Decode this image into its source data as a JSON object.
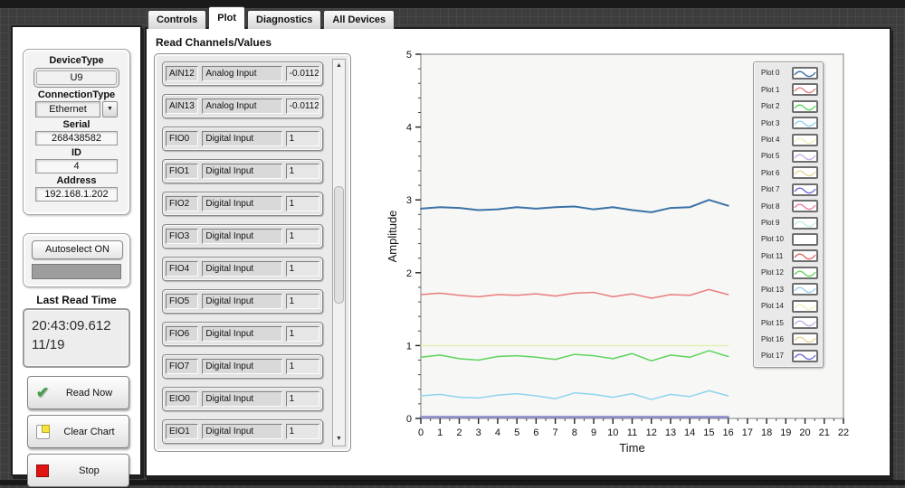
{
  "tabs": {
    "items": [
      {
        "label": "Controls",
        "active": false
      },
      {
        "label": "Plot",
        "active": true
      },
      {
        "label": "Diagnostics",
        "active": false
      },
      {
        "label": "All Devices",
        "active": false
      }
    ]
  },
  "device_panel": {
    "device_type_label": "DeviceType",
    "device_type_value": "U9",
    "connection_type_label": "ConnectionType",
    "connection_type_value": "Ethernet",
    "serial_label": "Serial",
    "serial_value": "268438582",
    "id_label": "ID",
    "id_value": "4",
    "address_label": "Address",
    "address_value": "192.168.1.202",
    "autoselect_button": "Autoselect ON",
    "last_read_time_label": "Last Read Time",
    "last_read_time_line1": "20:43:09.612",
    "last_read_time_line2": "11/19",
    "read_now_button": "Read Now",
    "clear_chart_button": "Clear Chart",
    "stop_button": "Stop"
  },
  "icons": {
    "dropdown_arrow": "▼",
    "scroll_up": "▲",
    "scroll_down": "▼"
  },
  "channels": {
    "header": "Read Channels/Values",
    "rows": [
      {
        "name": "AIN12",
        "type": "Analog Input",
        "value": "-0.0112"
      },
      {
        "name": "AIN13",
        "type": "Analog Input",
        "value": "-0.0112"
      },
      {
        "name": "FIO0",
        "type": "Digital Input",
        "value": "1"
      },
      {
        "name": "FIO1",
        "type": "Digital Input",
        "value": "1"
      },
      {
        "name": "FIO2",
        "type": "Digital Input",
        "value": "1"
      },
      {
        "name": "FIO3",
        "type": "Digital Input",
        "value": "1"
      },
      {
        "name": "FIO4",
        "type": "Digital Input",
        "value": "1"
      },
      {
        "name": "FIO5",
        "type": "Digital Input",
        "value": "1"
      },
      {
        "name": "FIO6",
        "type": "Digital Input",
        "value": "1"
      },
      {
        "name": "FIO7",
        "type": "Digital Input",
        "value": "1"
      },
      {
        "name": "EIO0",
        "type": "Digital Input",
        "value": "1"
      },
      {
        "name": "EIO1",
        "type": "Digital Input",
        "value": "1"
      }
    ]
  },
  "chart_data": {
    "type": "line",
    "title": "",
    "xlabel": "Time",
    "ylabel": "Amplitude",
    "xlim": [
      0,
      22
    ],
    "ylim": [
      0,
      5
    ],
    "x_ticks": [
      0,
      1,
      2,
      3,
      4,
      5,
      6,
      7,
      8,
      9,
      10,
      11,
      12,
      13,
      14,
      15,
      16,
      17,
      18,
      19,
      20,
      21,
      22
    ],
    "y_ticks": [
      0,
      1,
      2,
      3,
      4,
      5
    ],
    "grid": false,
    "plot_bg": "#f7f7f5",
    "x": [
      0,
      1,
      2,
      3,
      4,
      5,
      6,
      7,
      8,
      9,
      10,
      11,
      12,
      13,
      14,
      15,
      16
    ],
    "series": [
      {
        "name": "Plot 4",
        "color": "#dff0ae",
        "width": 1.4,
        "values": [
          1.0,
          1.0,
          1.0,
          1.0,
          1.0,
          1.0,
          1.0,
          1.0,
          1.0,
          1.0,
          1.0,
          1.0,
          1.0,
          1.0,
          1.0,
          1.0,
          1.0
        ]
      },
      {
        "name": "Plot 5",
        "color": "#9091cd",
        "width": 2.6,
        "values": [
          0.02,
          0.02,
          0.02,
          0.02,
          0.02,
          0.02,
          0.02,
          0.02,
          0.02,
          0.02,
          0.02,
          0.02,
          0.02,
          0.02,
          0.02,
          0.02,
          0.02
        ]
      },
      {
        "name": "Plot 3",
        "color": "#8ed4ee",
        "width": 1.5,
        "values": [
          0.31,
          0.33,
          0.29,
          0.28,
          0.32,
          0.34,
          0.31,
          0.27,
          0.35,
          0.33,
          0.29,
          0.34,
          0.26,
          0.33,
          0.3,
          0.38,
          0.31
        ]
      },
      {
        "name": "Plot 2",
        "color": "#5cd45c",
        "width": 1.5,
        "values": [
          0.84,
          0.87,
          0.82,
          0.8,
          0.85,
          0.86,
          0.84,
          0.81,
          0.88,
          0.86,
          0.82,
          0.89,
          0.79,
          0.87,
          0.84,
          0.93,
          0.85
        ]
      },
      {
        "name": "Plot 1",
        "color": "#e87c7c",
        "width": 1.5,
        "values": [
          1.7,
          1.72,
          1.69,
          1.67,
          1.7,
          1.69,
          1.71,
          1.68,
          1.72,
          1.73,
          1.67,
          1.71,
          1.65,
          1.7,
          1.69,
          1.77,
          1.7
        ]
      },
      {
        "name": "Plot 0",
        "color": "#3b72a6",
        "width": 2.0,
        "values": [
          2.88,
          2.9,
          2.89,
          2.86,
          2.87,
          2.9,
          2.88,
          2.9,
          2.91,
          2.87,
          2.9,
          2.86,
          2.83,
          2.89,
          2.9,
          3.0,
          2.92
        ]
      }
    ],
    "legend": {
      "position": "right-inside",
      "entries": [
        {
          "label": "Plot 0",
          "color": "#3b72a6"
        },
        {
          "label": "Plot 1",
          "color": "#e87c7c"
        },
        {
          "label": "Plot 2",
          "color": "#5cd45c"
        },
        {
          "label": "Plot 3",
          "color": "#8ed4ee"
        },
        {
          "label": "Plot 4",
          "color": "#eff0bc"
        },
        {
          "label": "Plot 5",
          "color": "#c9aee6"
        },
        {
          "label": "Plot 6",
          "color": "#e6d79c"
        },
        {
          "label": "Plot 7",
          "color": "#6f6fd8"
        },
        {
          "label": "Plot 8",
          "color": "#e8849e"
        },
        {
          "label": "Plot 9",
          "color": "#c2f0de"
        },
        {
          "label": "Plot 10",
          "color": "none"
        },
        {
          "label": "Plot 11",
          "color": "#e06c6c"
        },
        {
          "label": "Plot 12",
          "color": "#63d663"
        },
        {
          "label": "Plot 13",
          "color": "#9fd0ee"
        },
        {
          "label": "Plot 14",
          "color": "#eff0bc"
        },
        {
          "label": "Plot 15",
          "color": "#c9aee6"
        },
        {
          "label": "Plot 16",
          "color": "#e6d79c"
        },
        {
          "label": "Plot 17",
          "color": "#6f6fd8"
        }
      ]
    }
  }
}
